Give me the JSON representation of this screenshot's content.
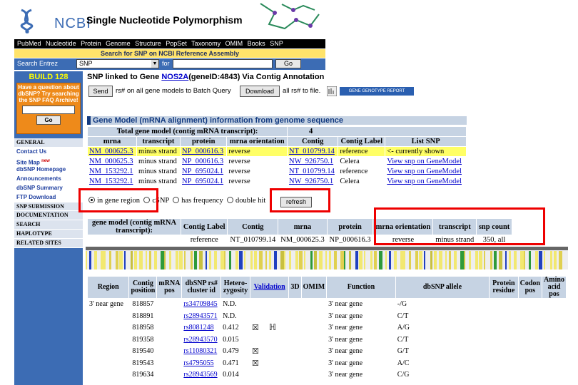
{
  "header": {
    "logo_text": "NCBI",
    "title": "Single Nucleotide Polymorphism"
  },
  "topnav": [
    "PubMed",
    "Nucleotide",
    "Protein",
    "Genome",
    "Structure",
    "PopSet",
    "Taxonomy",
    "OMIM",
    "Books",
    "SNP"
  ],
  "subbar": "Search for SNP on NCBI Reference Assembly",
  "search": {
    "label": "Search Entrez",
    "db_value": "SNP",
    "for_label": "for",
    "term_value": "",
    "go_label": "Go"
  },
  "sidebar": {
    "build": "BUILD 128",
    "faq_text": "Have a question about dbSNP? Try searching the SNP FAQ Archive!",
    "faq_go": "Go",
    "items": [
      {
        "label": "GENERAL",
        "kind": "hdr"
      },
      {
        "label": "Contact Us",
        "kind": "lnk"
      },
      {
        "label": "Site Map",
        "kind": "lnk",
        "badge": "new"
      },
      {
        "label": "dbSNP Homepage",
        "kind": "lnk"
      },
      {
        "label": "Announcements",
        "kind": "lnk"
      },
      {
        "label": "dbSNP Summary",
        "kind": "lnk"
      },
      {
        "label": "FTP Download",
        "kind": "lnk"
      },
      {
        "label": "SNP SUBMISSION",
        "kind": "hdr"
      },
      {
        "label": "DOCUMENTATION",
        "kind": "hdr"
      },
      {
        "label": "SEARCH",
        "kind": "hdr"
      },
      {
        "label": "HAPLOTYPE",
        "kind": "hdr"
      },
      {
        "label": "RELATED SITES",
        "kind": "hdr"
      }
    ]
  },
  "linked": {
    "prefix": "SNP linked to Gene ",
    "gene": "NOS2A",
    "suffix": "(geneID:4843) Via Contig Annotation"
  },
  "batch": {
    "send_label": "Send",
    "send_text": "rs# on all gene models to Batch Query",
    "download_label": "Download",
    "download_text": "all rs# to file.",
    "badge_text": "GENE GENOTYPE REPORT"
  },
  "gene_model": {
    "heading": "Gene Model (mRNA alignment) information from genome sequence",
    "total_label": "Total gene model (contig mRNA transcript):",
    "total_value": "4",
    "columns": [
      "mrna",
      "transcript",
      "protein",
      "mrna orientation",
      "Contig",
      "Contig Label",
      "List SNP"
    ],
    "rows": [
      [
        "NM_000625.3",
        "minus strand",
        "NP_000616.3",
        "reverse",
        "NT_010799.14",
        "reference",
        "<- currently shown"
      ],
      [
        "NM_000625.3",
        "minus strand",
        "NP_000616.3",
        "reverse",
        "NW_926750.1",
        "Celera",
        "View snp on GeneModel"
      ],
      [
        "NM_153292.1",
        "minus strand",
        "NP_695024.1",
        "reverse",
        "NT_010799.14",
        "reference",
        "View snp on GeneModel"
      ],
      [
        "NM_153292.1",
        "minus strand",
        "NP_695024.1",
        "reverse",
        "NW_926750.1",
        "Celera",
        "View snp on GeneModel"
      ]
    ]
  },
  "filters": {
    "options": [
      "in gene region",
      "cSNP",
      "has frequency",
      "double hit"
    ],
    "selected": "in gene region",
    "refresh_label": "refresh"
  },
  "model_info": {
    "columns": [
      "gene model (contig mRNA transcript):",
      "Contig Label",
      "Contig",
      "mrna",
      "protein",
      "mrna orientation",
      "transcript",
      "snp count"
    ],
    "values": [
      "",
      "reference",
      "NT_010799.14",
      "NM_000625.3",
      "NP_000616.3",
      "reverse",
      "minus strand",
      "350, all"
    ]
  },
  "snp_table": {
    "columns": [
      "Region",
      "Contig position",
      "mRNA pos",
      "dbSNP rs# cluster id",
      "Hetero-zygosity",
      "Validation",
      "3D",
      "OMIM",
      "Function",
      "dbSNP allele",
      "Protein residue",
      "Codon pos",
      "Amino acid pos"
    ],
    "rows": [
      [
        "3' near gene",
        "818857",
        "",
        "rs34709845",
        "N.D.",
        "",
        "",
        "",
        "3' near gene",
        "-/G"
      ],
      [
        "",
        "818891",
        "",
        "rs28943571",
        "N.D.",
        "",
        "",
        "",
        "3' near gene",
        "C/T"
      ],
      [
        "",
        "818958",
        "",
        "rs8081248",
        "0.412",
        "check+HapMap",
        "",
        "",
        "3' near gene",
        "A/G"
      ],
      [
        "",
        "819358",
        "",
        "rs28943570",
        "0.015",
        "",
        "",
        "",
        "3' near gene",
        "C/T"
      ],
      [
        "",
        "819540",
        "",
        "rs11080321",
        "0.479",
        "check",
        "",
        "",
        "3' near gene",
        "G/T"
      ],
      [
        "",
        "819543",
        "",
        "rs4795055",
        "0.471",
        "check",
        "",
        "",
        "3' near gene",
        "A/C"
      ],
      [
        "",
        "819634",
        "",
        "rs28943569",
        "0.014",
        "",
        "",
        "",
        "3' near gene",
        "C/G"
      ]
    ]
  },
  "colors": {
    "sidebar": "#3c6cb4",
    "highlight": "#ffff66",
    "header_cell": "#c6d3e3",
    "annotation_box": "#ee0000"
  }
}
